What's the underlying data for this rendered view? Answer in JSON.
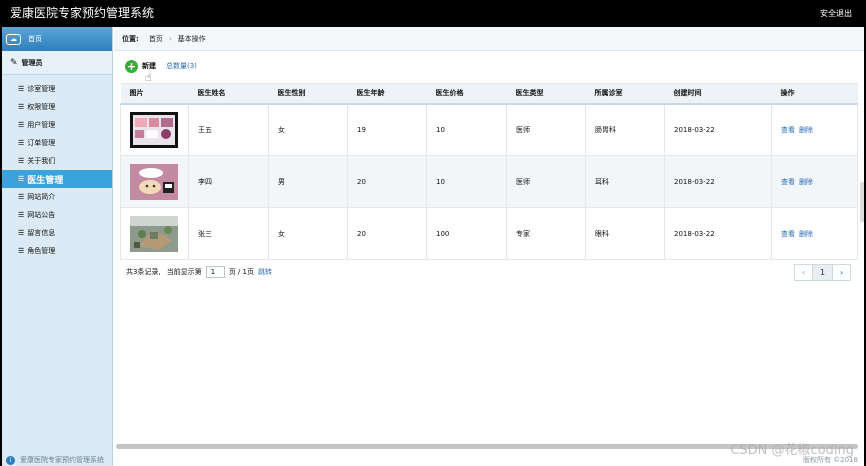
{
  "app": {
    "title": "爱康医院专家预约管理系统",
    "logout": "安全退出"
  },
  "sidebar": {
    "home": "首页",
    "group": "管理员",
    "items": [
      {
        "label": "诊室管理"
      },
      {
        "label": "权限管理"
      },
      {
        "label": "用户管理"
      },
      {
        "label": "订单管理"
      },
      {
        "label": "关于我们"
      },
      {
        "label": "医生管理"
      },
      {
        "label": "网站简介"
      },
      {
        "label": "网站公告"
      },
      {
        "label": "留言信息"
      },
      {
        "label": "角色管理"
      }
    ],
    "footer": "爱康医院专家预约管理系统"
  },
  "breadcrumb": {
    "prefix": "位置:",
    "home": "首页",
    "current": "基本操作"
  },
  "toolbar": {
    "new_label": "新建",
    "total_label": "总数量(3)"
  },
  "table": {
    "headers": [
      "图片",
      "医生姓名",
      "医生性别",
      "医生年龄",
      "医生价格",
      "医生类型",
      "所属诊室",
      "创建时间",
      "操作"
    ],
    "rows": [
      {
        "name": "王五",
        "gender": "女",
        "age": "19",
        "price": "10",
        "type": "医师",
        "room": "肠胃科",
        "created": "2018-03-22",
        "view": "查看",
        "delete": "删除"
      },
      {
        "name": "李四",
        "gender": "男",
        "age": "20",
        "price": "10",
        "type": "医师",
        "room": "耳科",
        "created": "2018-03-22",
        "view": "查看",
        "delete": "删除"
      },
      {
        "name": "张三",
        "gender": "女",
        "age": "20",
        "price": "100",
        "type": "专家",
        "room": "眼科",
        "created": "2018-03-22",
        "view": "查看",
        "delete": "删除"
      }
    ]
  },
  "pager": {
    "summary": "共3条记录,",
    "current_prefix": "当前显示第",
    "current_page": "1",
    "page_suffix": "页 / 1页",
    "jump": "跳转",
    "prev": "‹",
    "page": "1",
    "next": "›"
  },
  "footer_right": "版权所有 ©2018",
  "watermark": "CSDN @花椒coding"
}
